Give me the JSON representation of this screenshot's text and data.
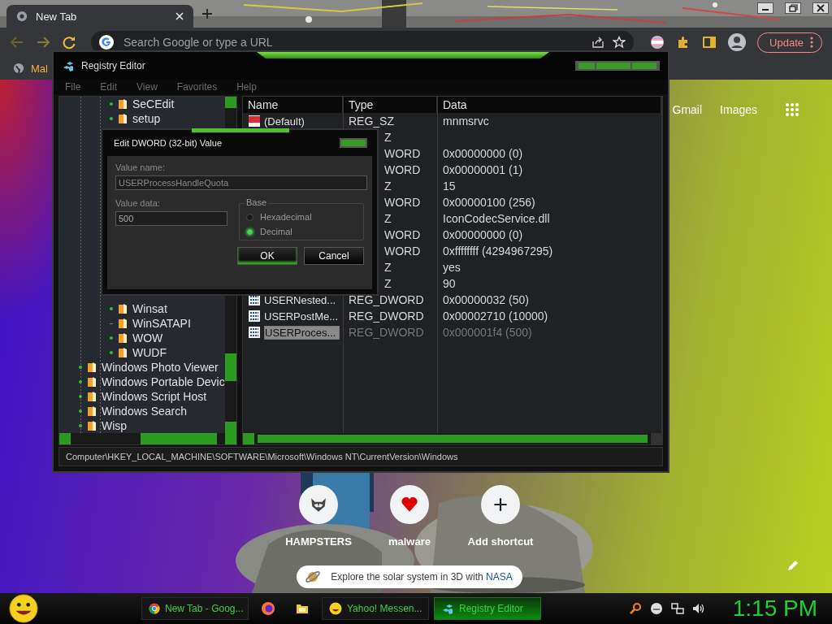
{
  "browser": {
    "tab": {
      "title": "New Tab"
    },
    "omnibox": {
      "placeholder": "Search Google or type a URL"
    },
    "update_button": {
      "label": "Update"
    },
    "bookmarks": [
      {
        "label": "Mal"
      }
    ]
  },
  "new_tab_page": {
    "links": [
      "Gmail",
      "Images"
    ],
    "shortcuts": [
      {
        "label": "HAMPSTERS",
        "kind": "site"
      },
      {
        "label": "malware",
        "kind": "heart"
      },
      {
        "label": "Add shortcut",
        "kind": "add"
      }
    ],
    "promo": {
      "text": "Explore the solar system in 3D with ",
      "link": "NASA"
    }
  },
  "registry_editor": {
    "title": "Registry Editor",
    "menu": [
      "File",
      "Edit",
      "View",
      "Favorites",
      "Help"
    ],
    "tree": [
      {
        "children": [
          {
            "children": [
              {
                "label": "SeCEdit",
                "expandable": true
              },
              {
                "label": "setup",
                "expandable": true
              },
              {
                "label": "Winsat",
                "expandable": true
              },
              {
                "label": "WinSATAPI",
                "expandable": false
              },
              {
                "label": "WOW",
                "expandable": true
              },
              {
                "label": "WUDF",
                "expandable": true
              }
            ]
          }
        ]
      },
      {
        "label": "Windows Photo Viewer",
        "expandable": true
      },
      {
        "label": "Windows Portable Devic",
        "expandable": true
      },
      {
        "label": "Windows Script Host",
        "expandable": true
      },
      {
        "label": "Windows Search",
        "expandable": true
      },
      {
        "label": "Wisp",
        "expandable": true
      }
    ],
    "columns": [
      "Name",
      "Type",
      "Data"
    ],
    "rows": [
      {
        "name": "(Default)",
        "kind": "string",
        "type": "REG_SZ",
        "data": "mnmsrvc",
        "selected": false
      },
      {
        "type": "Z",
        "selected": false
      },
      {
        "type": "WORD",
        "data": "0x00000000 (0)",
        "selected": false
      },
      {
        "type": "WORD",
        "data": "0x00000001 (1)",
        "selected": false
      },
      {
        "type": "Z",
        "data": "15",
        "selected": false
      },
      {
        "type": "WORD",
        "data": "0x00000100 (256)",
        "selected": false
      },
      {
        "type": "Z",
        "data": "IconCodecService.dll",
        "selected": false
      },
      {
        "type": "WORD",
        "data": "0x00000000 (0)",
        "selected": false
      },
      {
        "type": "WORD",
        "data": "0xffffffff (4294967295)",
        "selected": false
      },
      {
        "type": "Z",
        "data": "yes",
        "selected": false
      },
      {
        "type": "Z",
        "data": "90",
        "selected": false
      },
      {
        "name": "USERNested...",
        "kind": "binary",
        "type": "REG_DWORD",
        "data": "0x00000032 (50)",
        "selected": false
      },
      {
        "name": "USERPostMe...",
        "kind": "binary",
        "type": "REG_DWORD",
        "data": "0x00002710 (10000)",
        "selected": false
      },
      {
        "name": "USERProces...",
        "kind": "binary",
        "type": "REG_DWORD",
        "data": "0x000001f4 (500)",
        "selected": true
      }
    ],
    "status_path": "Computer\\HKEY_LOCAL_MACHINE\\SOFTWARE\\Microsoft\\Windows NT\\CurrentVersion\\Windows"
  },
  "dialog": {
    "title": "Edit DWORD (32-bit) Value",
    "value_name_label": "Value name:",
    "value_name": "USERProcessHandleQuota",
    "value_data_label": "Value data:",
    "value_data": "500",
    "base_label": "Base",
    "base_options": [
      {
        "label": "Hexadecimal",
        "selected": false
      },
      {
        "label": "Decimal",
        "selected": true
      }
    ],
    "buttons": [
      {
        "label": "OK",
        "kind": "default"
      },
      {
        "label": "Cancel",
        "kind": "normal"
      }
    ]
  },
  "taskbar": {
    "tasks": [
      {
        "label": "New Tab - Goog...",
        "kind": "chrome",
        "selected": false
      },
      {
        "kind": "firefox",
        "selected": false
      },
      {
        "kind": "folder",
        "selected": false
      },
      {
        "label": "Yahoo! Messen...",
        "kind": "messenger",
        "selected": false
      },
      {
        "label": "Registry Editor",
        "kind": "regedit",
        "selected": true
      }
    ],
    "clock": "1:15 PM"
  }
}
